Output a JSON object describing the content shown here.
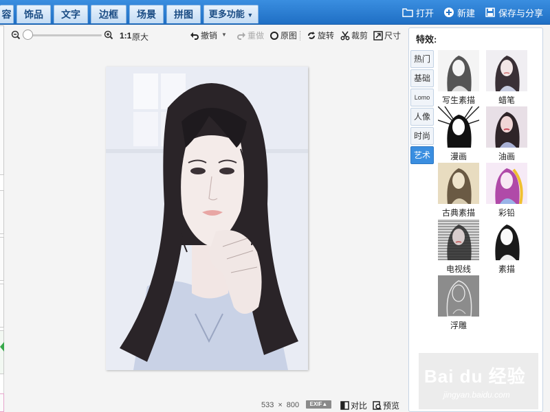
{
  "menu": {
    "tabs": [
      "容",
      "饰品",
      "文字",
      "边框",
      "场景",
      "拼图",
      "更多功能"
    ]
  },
  "top_actions": {
    "open": "打开",
    "new": "新建",
    "save_share": "保存与分享"
  },
  "toolbar": {
    "zoom_ratio": "1:1",
    "original_size": "原大",
    "undo": "撤销",
    "redo": "重做",
    "original": "原图",
    "rotate": "旋转",
    "crop": "裁剪",
    "size": "尺寸"
  },
  "status": {
    "width": "533",
    "times": "×",
    "height": "800",
    "exif": "EXIF▲",
    "compare": "对比",
    "preview": "预览"
  },
  "effects_panel": {
    "title": "特效:",
    "categories": [
      "热门",
      "基础",
      "Lomo",
      "人像",
      "时尚",
      "艺术"
    ],
    "active_category": "艺术",
    "effects": [
      "写生素描",
      "蜡笔",
      "漫画",
      "油画",
      "古典素描",
      "彩铅",
      "电视线",
      "素描",
      "浮雕"
    ]
  },
  "watermark": {
    "main": "Bai du 经验",
    "sub": "jingyan.baidu.com"
  },
  "colors": {
    "accent": "#3a8ee0",
    "topbar": "#1f6fc4",
    "tab_text": "#1a4c84"
  }
}
